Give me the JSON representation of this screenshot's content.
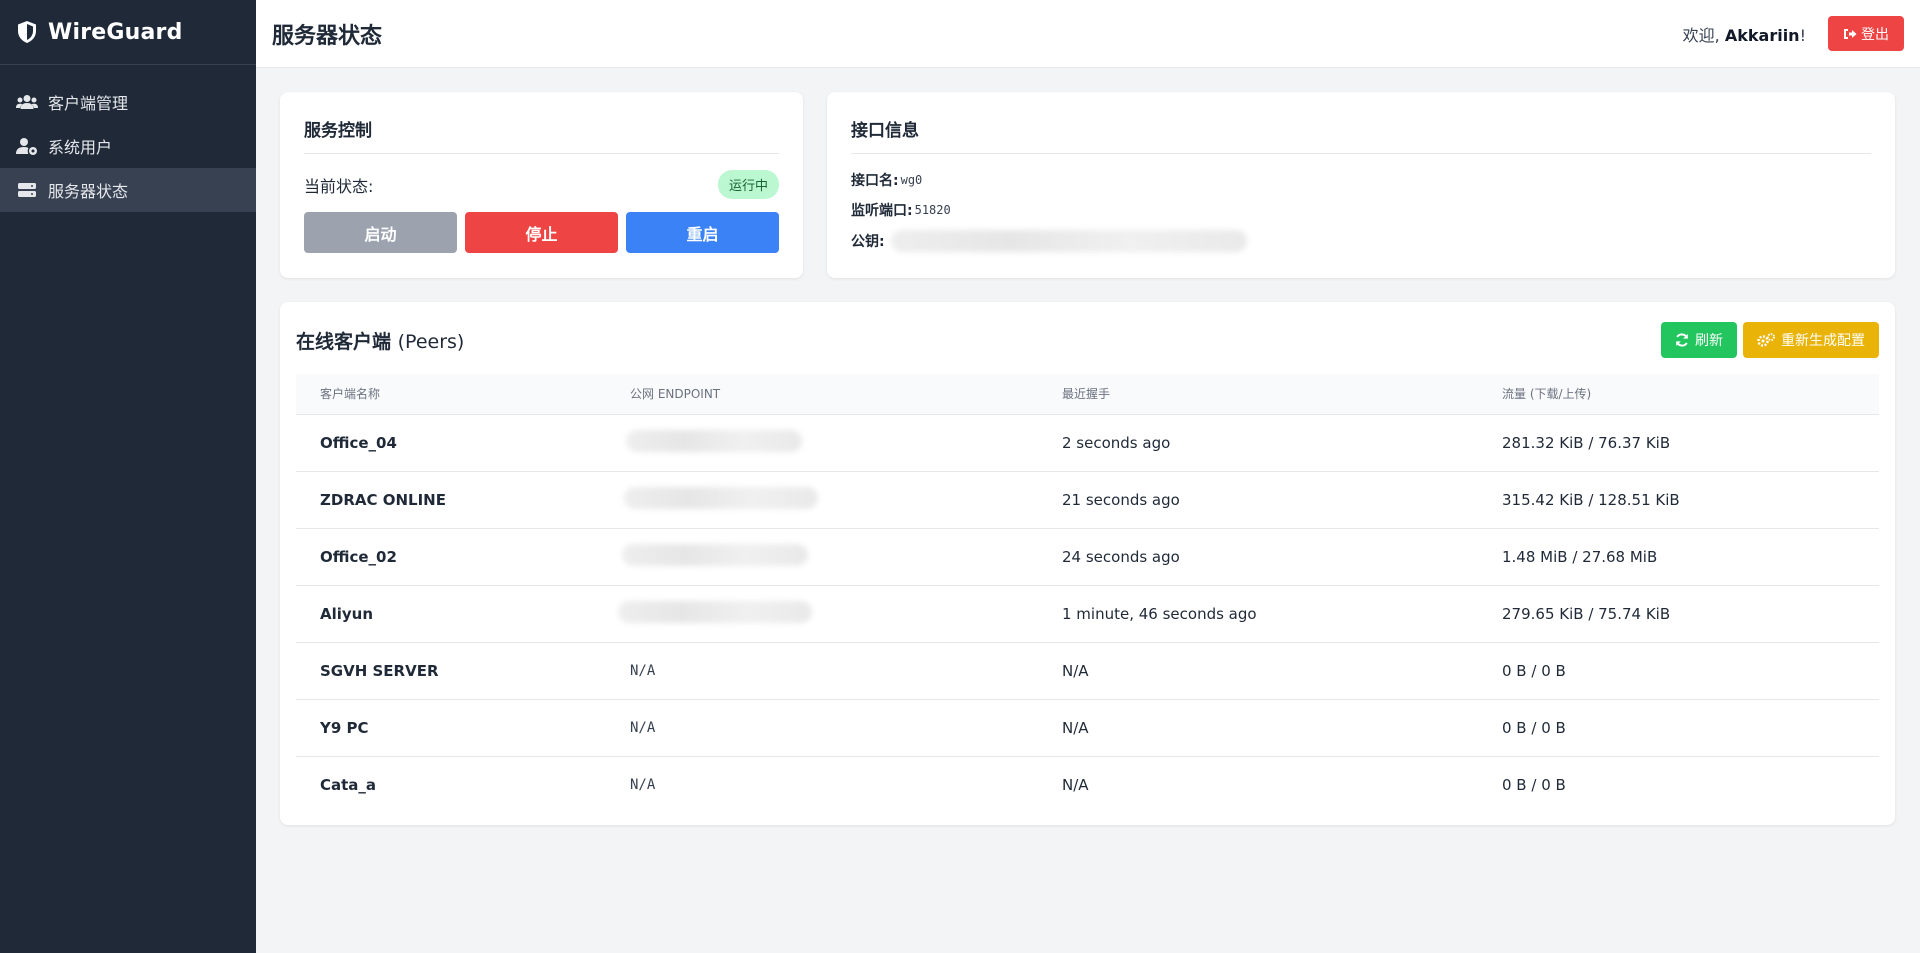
{
  "brand": {
    "name": "WireGuard",
    "icon": "shield-icon"
  },
  "sidebar": {
    "items": [
      {
        "label": "客户端管理",
        "icon": "users-icon",
        "active": false
      },
      {
        "label": "系统用户",
        "icon": "user-cog-icon",
        "active": false
      },
      {
        "label": "服务器状态",
        "icon": "server-icon",
        "active": true
      }
    ]
  },
  "header": {
    "title": "服务器状态",
    "welcome_prefix": "欢迎, ",
    "username": "Akkariin",
    "welcome_suffix": "!",
    "logout_label": "登出"
  },
  "service": {
    "title": "服务控制",
    "status_label": "当前状态:",
    "status_value": "运行中",
    "start_label": "启动",
    "stop_label": "停止",
    "restart_label": "重启"
  },
  "interface": {
    "title": "接口信息",
    "name_label": "接口名:",
    "name_value": "wg0",
    "port_label": "监听端口:",
    "port_value": "51820",
    "pubkey_label": "公钥:"
  },
  "peers": {
    "title_cn": "在线客户端",
    "title_en": "(Peers)",
    "refresh_label": "刷新",
    "regen_label": "重新生成配置",
    "columns": [
      "客户端名称",
      "公网 ENDPOINT",
      "最近握手",
      "流量 (下载/上传)"
    ],
    "rows": [
      {
        "name": "Office_04",
        "endpoint": "",
        "handshake": "2 seconds ago",
        "traffic": "281.32 KiB / 76.37 KiB"
      },
      {
        "name": "ZDRAC ONLINE",
        "endpoint": "",
        "handshake": "21 seconds ago",
        "traffic": "315.42 KiB / 128.51 KiB"
      },
      {
        "name": "Office_02",
        "endpoint": "",
        "handshake": "24 seconds ago",
        "traffic": "1.48 MiB / 27.68 MiB"
      },
      {
        "name": "Aliyun",
        "endpoint": "",
        "handshake": "1 minute, 46 seconds ago",
        "traffic": "279.65 KiB / 75.74 KiB"
      },
      {
        "name": "SGVH SERVER",
        "endpoint": "N/A",
        "handshake": "N/A",
        "traffic": "0 B / 0 B"
      },
      {
        "name": "Y9 PC",
        "endpoint": "N/A",
        "handshake": "N/A",
        "traffic": "0 B / 0 B"
      },
      {
        "name": "Cata_a",
        "endpoint": "N/A",
        "handshake": "N/A",
        "traffic": "0 B / 0 B"
      }
    ]
  },
  "colors": {
    "sidebar_bg": "#1f2937",
    "danger": "#ef4444",
    "primary": "#3b82f6",
    "success": "#22c55e",
    "warning": "#eab308",
    "muted": "#9ca3af"
  }
}
